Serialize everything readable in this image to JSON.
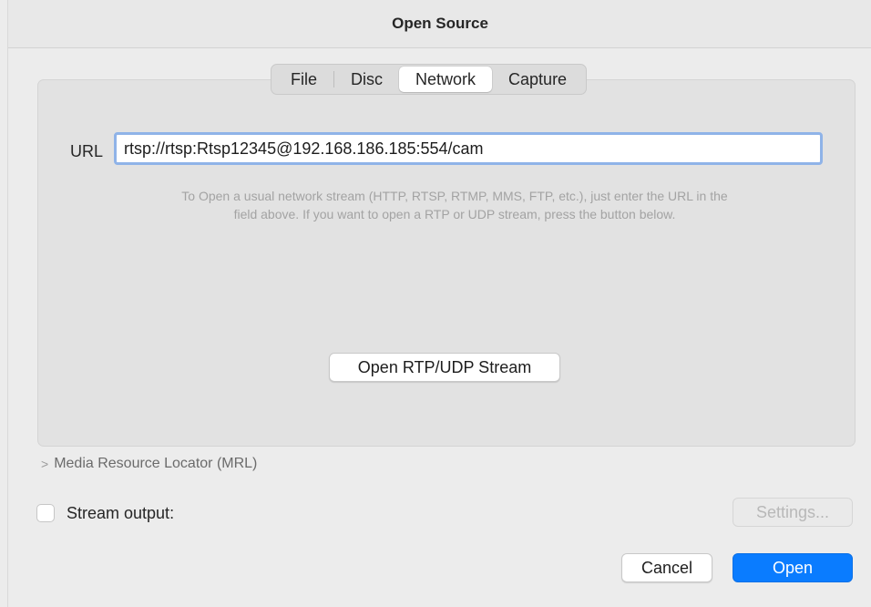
{
  "window": {
    "title": "Open Source"
  },
  "tabs": [
    {
      "label": "File",
      "selected": false
    },
    {
      "label": "Disc",
      "selected": false
    },
    {
      "label": "Network",
      "selected": true
    },
    {
      "label": "Capture",
      "selected": false
    }
  ],
  "network": {
    "url_label": "URL",
    "url_value": "rtsp://rtsp:Rtsp12345@192.168.186.185:554/cam",
    "hint_line1": "To Open a usual network stream (HTTP, RTSP, RTMP, MMS, FTP, etc.), just enter the URL in the",
    "hint_line2": "field above. If you want to open a RTP or UDP stream, press the button below.",
    "rtp_button": "Open RTP/UDP Stream"
  },
  "mrl": {
    "chevron": ">",
    "label": "Media Resource Locator (MRL)"
  },
  "stream_output": {
    "label": "Stream output:",
    "checked": false,
    "settings_button": "Settings..."
  },
  "footer": {
    "cancel_label": "Cancel",
    "open_label": "Open"
  },
  "colors": {
    "accent": "#0a7cff",
    "focus_ring": "#8fb3e8",
    "window_bg": "#ececec",
    "panel_bg": "#e2e2e2"
  },
  "icons": {
    "disclosure": "chevron-right-icon"
  }
}
